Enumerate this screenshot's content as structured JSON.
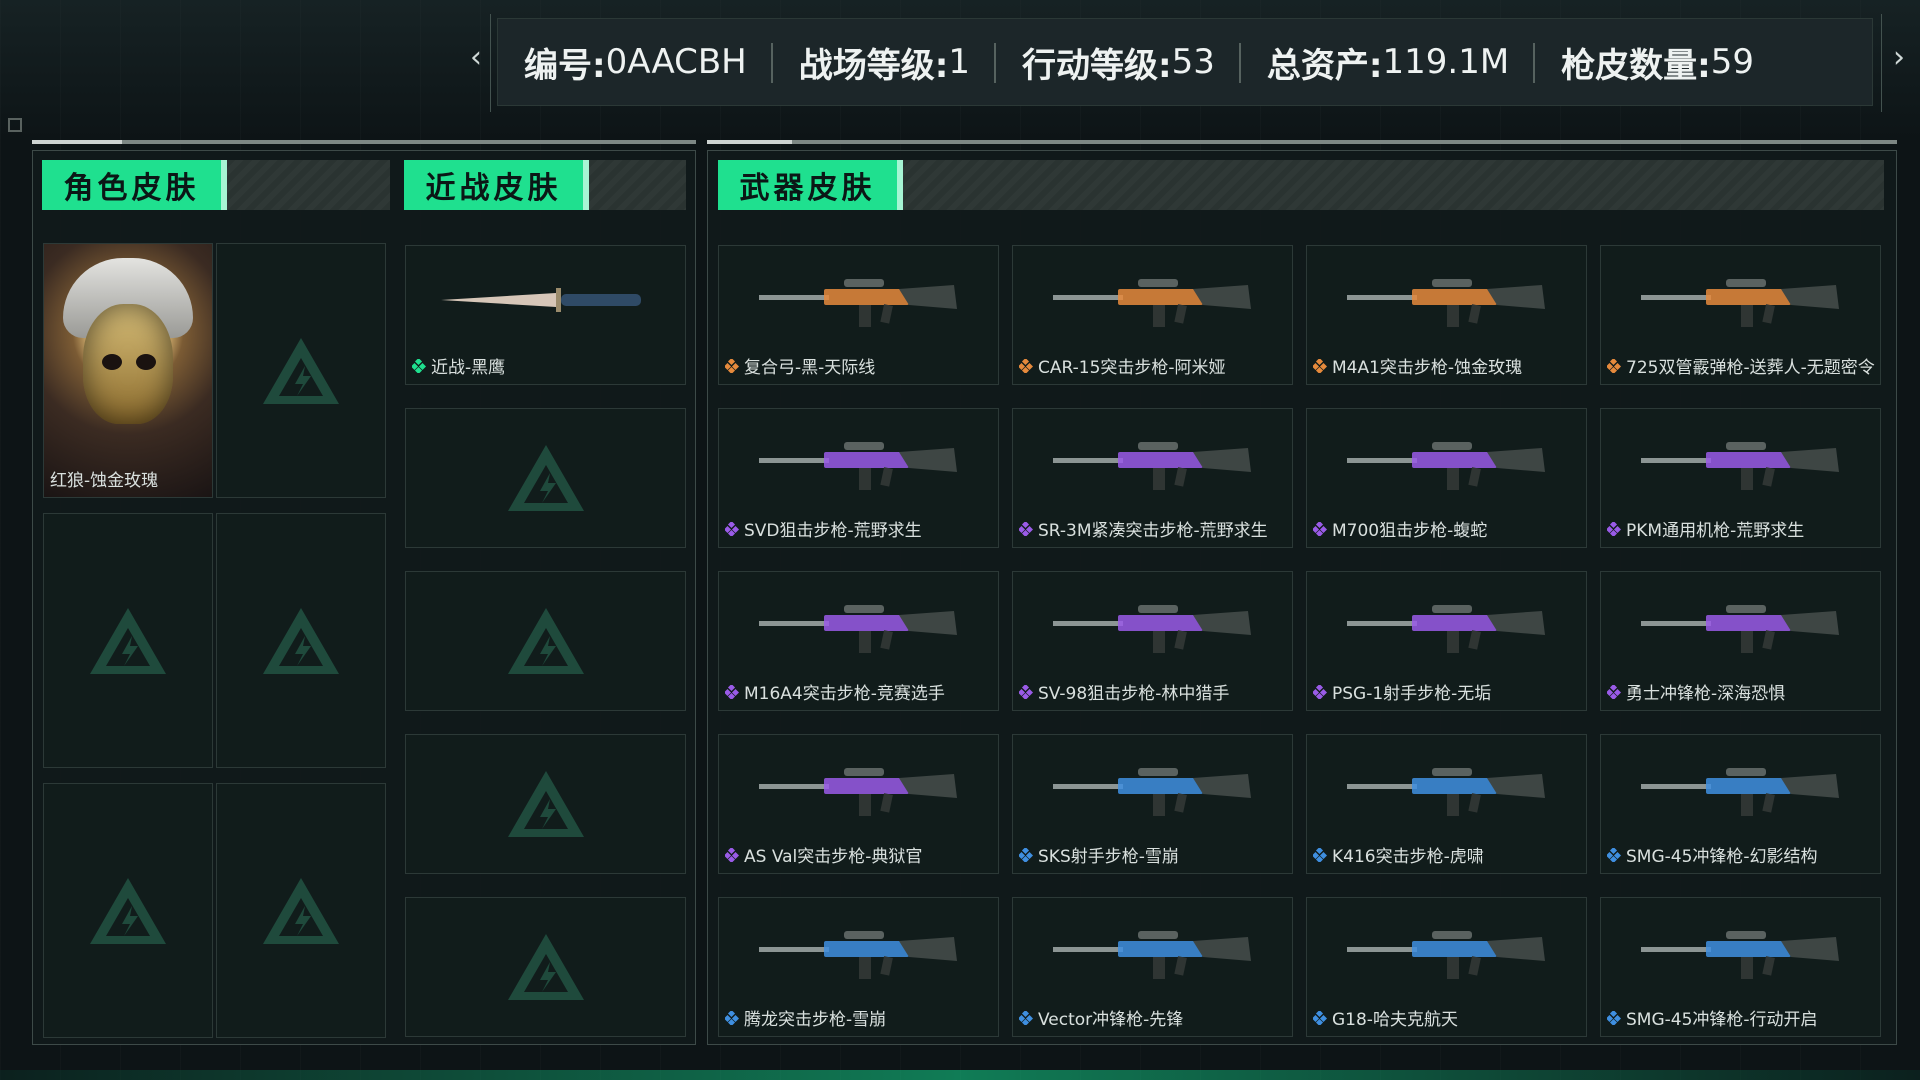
{
  "colors": {
    "accent": "#1fe08f",
    "orange": "#e68a3c",
    "purple": "#9a5be8",
    "blue": "#3f8fe0",
    "red": "#e05050",
    "gray": "#6d7572"
  },
  "header": {
    "stats": [
      {
        "label": "编号:",
        "value": "0AACBH"
      },
      {
        "label": "战场等级:",
        "value": "1"
      },
      {
        "label": "行动等级:",
        "value": "53"
      },
      {
        "label": "总资产:",
        "value": "119.1M"
      },
      {
        "label": "枪皮数量:",
        "value": "59"
      }
    ],
    "prev_icon": "chevron-left-icon",
    "next_icon": "chevron-right-icon"
  },
  "sections": {
    "character": {
      "title": "角色皮肤"
    },
    "melee": {
      "title": "近战皮肤"
    },
    "weapon": {
      "title": "武器皮肤"
    }
  },
  "character_skins": [
    {
      "name": "红狼-蚀金玫瑰",
      "rarity": "red"
    },
    {
      "name": "",
      "rarity": "gray"
    },
    {
      "name": "",
      "rarity": "gray"
    },
    {
      "name": "",
      "rarity": "gray"
    },
    {
      "name": "",
      "rarity": "gray"
    },
    {
      "name": "",
      "rarity": "gray"
    }
  ],
  "melee_skins": [
    {
      "name": "近战-黑鹰",
      "rarity": "green"
    },
    {
      "name": "",
      "rarity": "gray"
    },
    {
      "name": "",
      "rarity": "gray"
    },
    {
      "name": "",
      "rarity": "gray"
    },
    {
      "name": "",
      "rarity": "gray"
    }
  ],
  "weapon_skins": [
    {
      "name": "复合弓-黑-天际线",
      "rarity": "orange"
    },
    {
      "name": "CAR-15突击步枪-阿米娅",
      "rarity": "orange"
    },
    {
      "name": "M4A1突击步枪-蚀金玫瑰",
      "rarity": "orange"
    },
    {
      "name": "725双管霰弹枪-送葬人-无题密令",
      "rarity": "orange"
    },
    {
      "name": "SVD狙击步枪-荒野求生",
      "rarity": "purple"
    },
    {
      "name": "SR-3M紧凑突击步枪-荒野求生",
      "rarity": "purple"
    },
    {
      "name": "M700狙击步枪-蝮蛇",
      "rarity": "purple"
    },
    {
      "name": "PKM通用机枪-荒野求生",
      "rarity": "purple"
    },
    {
      "name": "M16A4突击步枪-竞赛选手",
      "rarity": "purple"
    },
    {
      "name": "SV-98狙击步枪-林中猎手",
      "rarity": "purple"
    },
    {
      "name": "PSG-1射手步枪-无垢",
      "rarity": "purple"
    },
    {
      "name": "勇士冲锋枪-深海恐惧",
      "rarity": "purple"
    },
    {
      "name": "AS Val突击步枪-典狱官",
      "rarity": "purple"
    },
    {
      "name": "SKS射手步枪-雪崩",
      "rarity": "blue"
    },
    {
      "name": "K416突击步枪-虎啸",
      "rarity": "blue"
    },
    {
      "name": "SMG-45冲锋枪-幻影结构",
      "rarity": "blue"
    },
    {
      "name": "腾龙突击步枪-雪崩",
      "rarity": "blue"
    },
    {
      "name": "Vector冲锋枪-先锋",
      "rarity": "blue"
    },
    {
      "name": "G18-哈夫克航天",
      "rarity": "blue"
    },
    {
      "name": "SMG-45冲锋枪-行动开启",
      "rarity": "blue"
    }
  ]
}
